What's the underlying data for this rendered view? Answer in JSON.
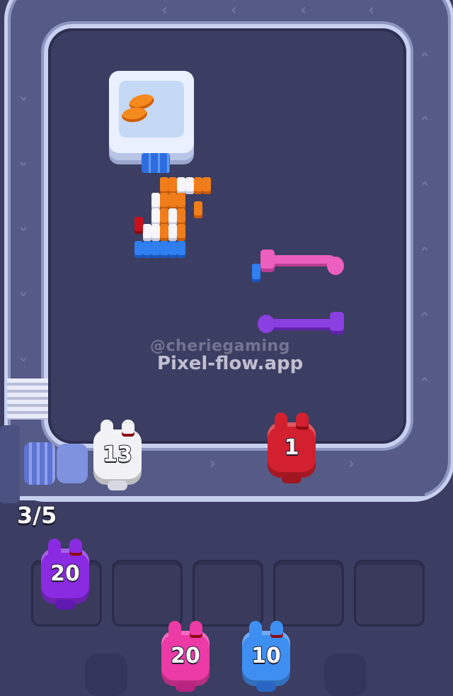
{
  "watermark": {
    "handle": "@cheriegaming",
    "site": "Pixel-flow.app"
  },
  "queue_counter": "3/5",
  "conveyor_bunnies": [
    {
      "id": "white",
      "value": "13",
      "color": "#f2f2f6"
    },
    {
      "id": "red",
      "value": "1",
      "color": "#d2202f"
    }
  ],
  "slot_bunnies": [
    {
      "id": "purple",
      "value": "20",
      "color": "#8a2be2"
    }
  ],
  "queue_bunnies": [
    {
      "id": "pink",
      "value": "20",
      "color": "#ec3aa6"
    },
    {
      "id": "blue",
      "value": "10",
      "color": "#3f8ff2"
    }
  ],
  "slots_total": 5,
  "colors": {
    "background": "#3c3d62",
    "track": "#555b86",
    "track_edge": "#c8d0ef",
    "orange": "#f07d1a",
    "blue": "#2f7ff0",
    "pink_rod": "#ec5fbe",
    "purple_rod": "#8a3fe0"
  }
}
